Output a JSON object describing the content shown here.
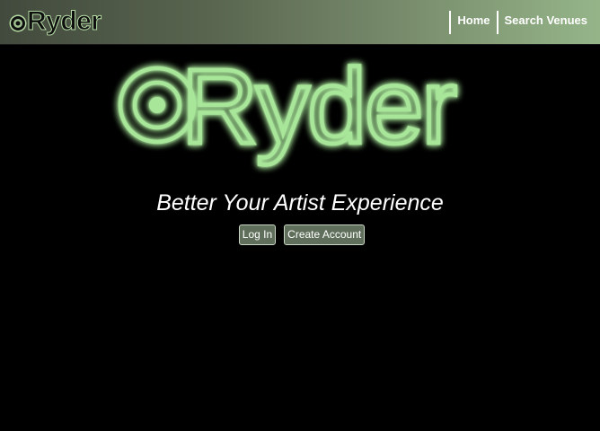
{
  "navbar": {
    "logo_text": "Ryder",
    "links": [
      {
        "label": "Home"
      },
      {
        "label": "Search Venues"
      }
    ]
  },
  "hero": {
    "logo_text": "Ryder",
    "glow_color": "#a8e69a",
    "tagline": "Better Your Artist Experience"
  },
  "actions": {
    "login_label": "Log In",
    "create_account_label": "Create Account"
  },
  "colors": {
    "background": "#000000",
    "button_bg": "#5f6f5b",
    "nav_gradient_start": "#424a3d",
    "nav_gradient_end": "#95b589"
  }
}
